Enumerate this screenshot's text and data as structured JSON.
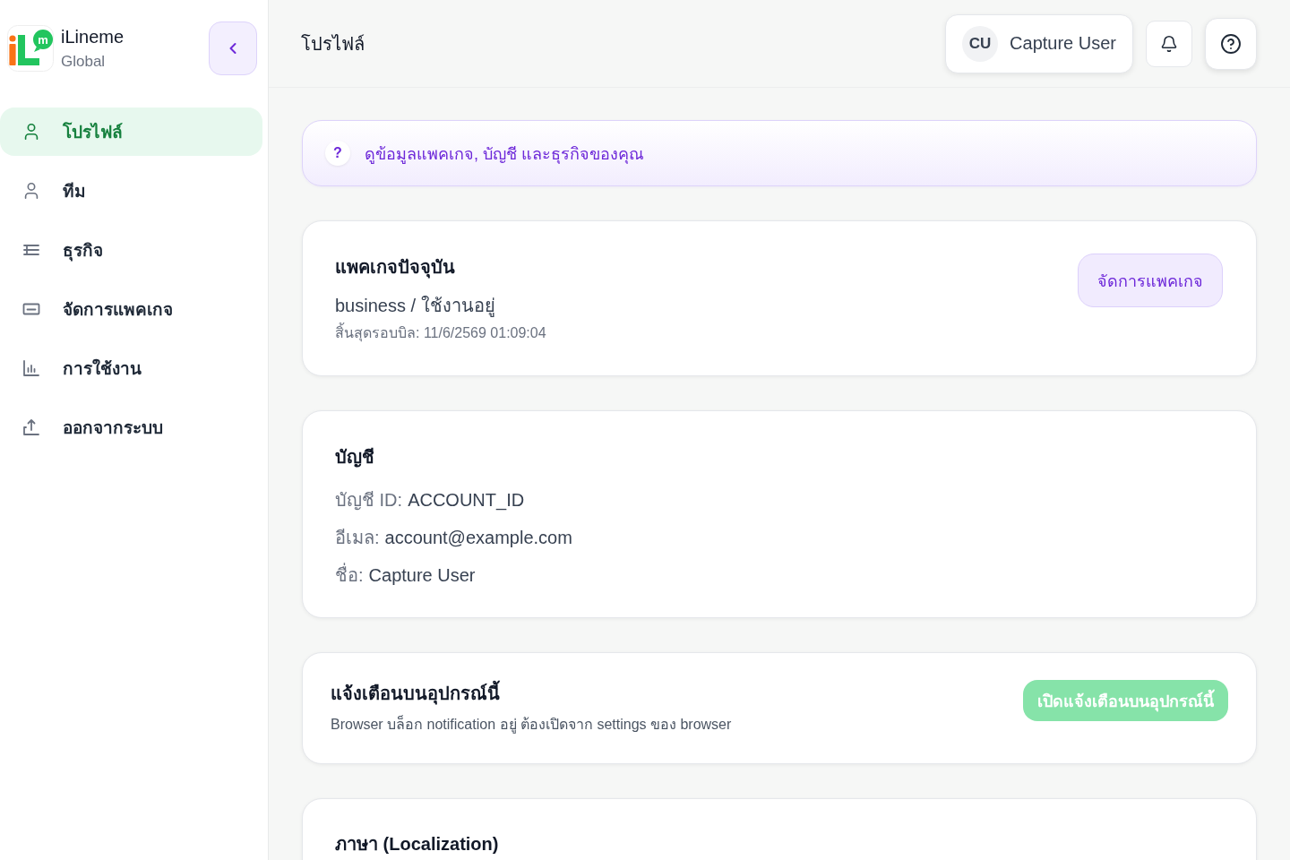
{
  "sidebar": {
    "brand": {
      "logo_mark": "m",
      "name": "iLineme",
      "subtitle": "Global"
    },
    "items": [
      {
        "kind": "profile",
        "label": "โปรไฟล์",
        "selected": true
      },
      {
        "kind": "team",
        "label": "ทีม",
        "selected": false
      },
      {
        "kind": "business",
        "label": "ธุรกิจ",
        "selected": false
      },
      {
        "kind": "package",
        "label": "จัดการแพคเกจ",
        "selected": false
      },
      {
        "kind": "usage",
        "label": "การใช้งาน",
        "selected": false
      },
      {
        "kind": "logout",
        "label": "ออกจากระบบ",
        "selected": false
      }
    ]
  },
  "header": {
    "title": "โปรไฟล์",
    "user": {
      "initials": "CU",
      "name": "Capture User"
    }
  },
  "banner": {
    "mark": "?",
    "text": "ดูข้อมูลแพคเกจ, บัญชี และธุรกิจของคุณ"
  },
  "package_card": {
    "title": "แพคเกจปัจจุบัน",
    "status": "business / ใช้งานอยู่",
    "billing_end": "สิ้นสุดรอบบิล: 11/6/2569 01:09:04",
    "button": "จัดการแพคเกจ"
  },
  "account_card": {
    "title": "บัญชี",
    "fields": [
      {
        "label": "บัญชี ID:",
        "value": "ACCOUNT_ID"
      },
      {
        "label": "อีเมล:",
        "value": "account@example.com"
      },
      {
        "label": "ชื่อ:",
        "value": "Capture User"
      }
    ]
  },
  "notification_card": {
    "title": "แจ้งเตือนบนอุปกรณ์นี้",
    "description": "Browser บล็อก notification อยู่ ต้องเปิดจาก settings ของ browser",
    "button": {
      "label": "เปิดแจ้งเตือนบนอุปกรณ์นี้",
      "disabled": true
    }
  },
  "language_card": {
    "title": "ภาษา (Localization)"
  }
}
